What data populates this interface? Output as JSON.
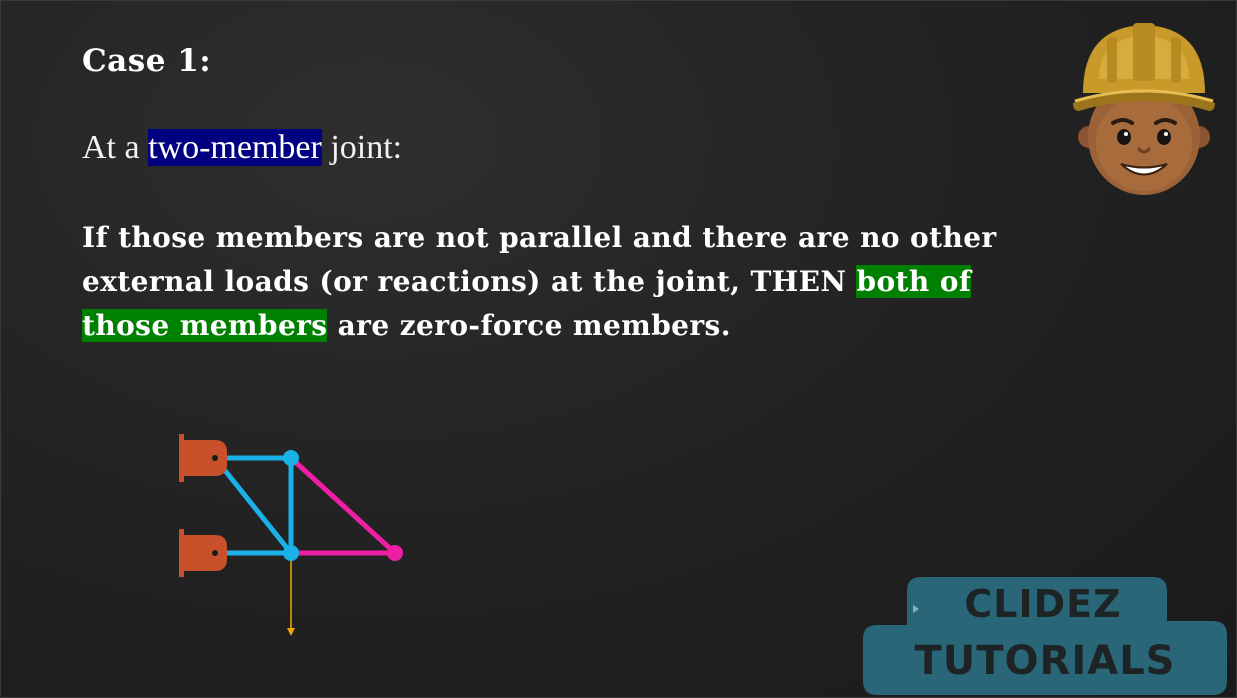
{
  "slide": {
    "heading": "Case 1:",
    "subline": {
      "prefix": "At a ",
      "highlight": "two-member",
      "suffix": " joint:"
    },
    "rule": {
      "line1": "If those members are not parallel and there are no other",
      "line2_prefix": "external loads (or reactions) at the joint, THEN ",
      "highlight_part1": "both of",
      "highlight_part2": "those members",
      "suffix": " are zero-force members."
    }
  },
  "logo": {
    "line1": "CLIDEZ",
    "line2": "TUTORIALS"
  },
  "colors": {
    "background": "#232323",
    "blue_highlight": "#000080",
    "green_highlight": "#008000",
    "member_cyan": "#1ab0e8",
    "member_magenta": "#ee1fa5",
    "support_orange": "#c8502a",
    "load_arrow": "#f0a800",
    "logo_teal": "#2a6e80",
    "logo_text": "#1e2426"
  },
  "icons": {
    "mascot": "worker-hardhat-icon",
    "supports": "pin-support-icon",
    "load": "downward-arrow-icon"
  }
}
